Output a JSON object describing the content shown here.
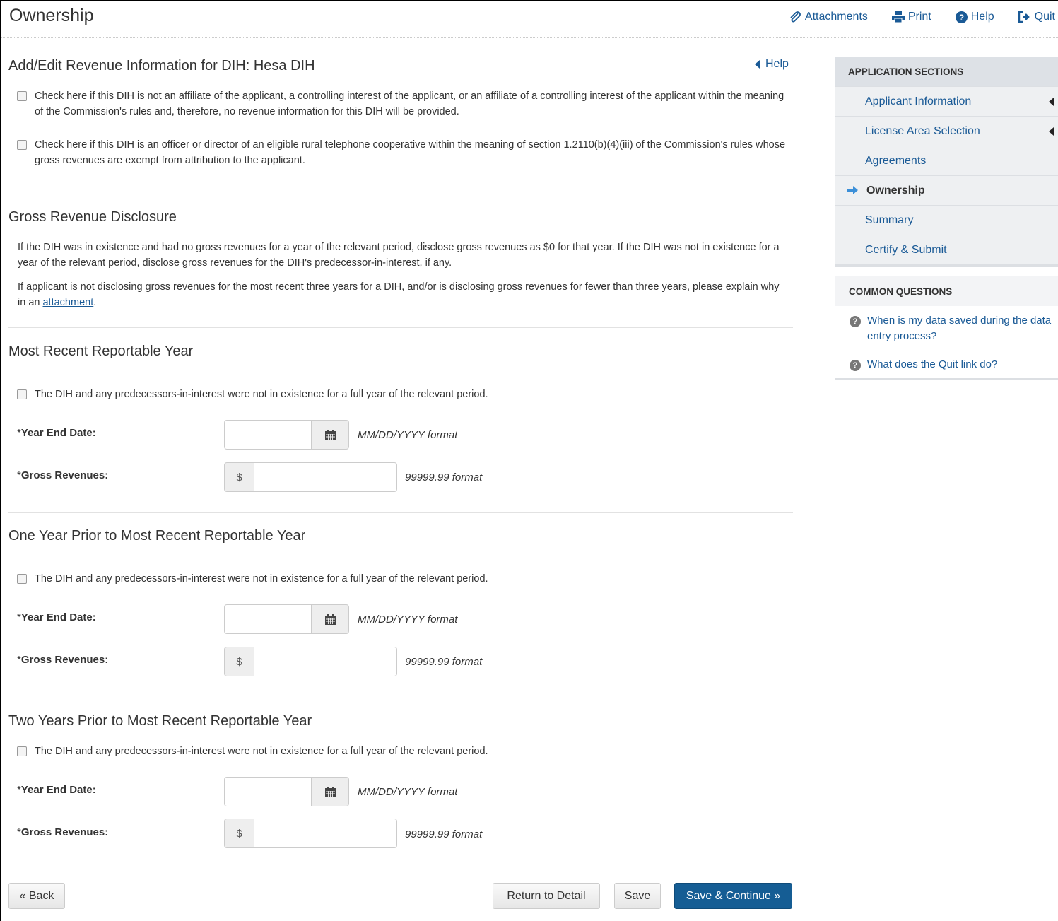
{
  "page": {
    "title": "Ownership"
  },
  "toplinks": {
    "attachments": "Attachments",
    "print": "Print",
    "help": "Help",
    "quit": "Quit"
  },
  "main": {
    "heading": "Add/Edit Revenue Information for DIH: Hesa DIH",
    "help": "Help",
    "check_affiliate": "Check here if this DIH is not an affiliate of the applicant, a controlling interest of the applicant, or an affiliate of a controlling interest of the applicant within the meaning of the Commission's rules and, therefore, no revenue information for this DIH will be provided.",
    "check_officer": "Check here if this DIH is an officer or director of an eligible rural telephone cooperative within the meaning of section 1.2110(b)(4)(iii) of the Commission's rules whose gross revenues are exempt from attribution to the applicant."
  },
  "disclosure": {
    "heading": "Gross Revenue Disclosure",
    "para1": "If the DIH was in existence and had no gross revenues for a year of the relevant period, disclose gross revenues as $0 for that year. If the DIH was not in existence for a year of the relevant period, disclose gross revenues for the DIH's predecessor-in-interest, if any.",
    "para2_prefix": "If applicant is not disclosing gross revenues for the most recent three years for a DIH, and/or is disclosing gross revenues for fewer than three years, please explain why in an ",
    "para2_link": "attachment",
    "para2_suffix": "."
  },
  "years": [
    {
      "heading": "Most Recent Reportable Year"
    },
    {
      "heading": "One Year Prior to Most Recent Reportable Year"
    },
    {
      "heading": "Two Years Prior to Most Recent Reportable Year"
    }
  ],
  "form": {
    "existence_check": "The DIH and any predecessors-in-interest were not in existence for a full year of the relevant period.",
    "required_mark": "*",
    "year_end_label": "Year End Date:",
    "date_hint": "MM/DD/YYYY format",
    "gross_label": "Gross Revenues:",
    "currency": "$",
    "money_hint": "99999.99 format",
    "year_end_value": "",
    "gross_value": ""
  },
  "buttons": {
    "back": "« Back",
    "return": "Return to Detail",
    "save": "Save",
    "save_continue": "Save & Continue »"
  },
  "sidebar": {
    "head": "APPLICATION SECTIONS",
    "items": [
      {
        "label": "Applicant Information"
      },
      {
        "label": "License Area Selection"
      },
      {
        "label": "Agreements"
      },
      {
        "label": "Ownership"
      },
      {
        "label": "Summary"
      },
      {
        "label": "Certify & Submit"
      }
    ],
    "cq_head": "COMMON QUESTIONS",
    "questions": [
      {
        "label": "When is my data saved during the data entry process?"
      },
      {
        "label": "What does the Quit link do?"
      }
    ]
  },
  "colors": {
    "link": "#1a5a96",
    "primary_button": "#155d94"
  }
}
